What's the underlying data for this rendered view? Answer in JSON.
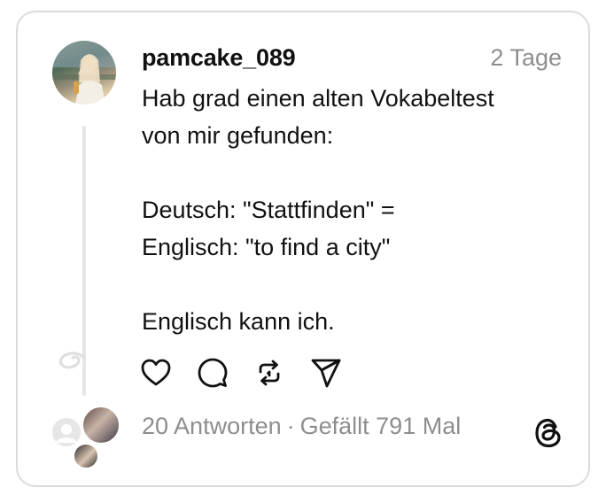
{
  "post": {
    "username": "pamcake_089",
    "time": "2 Tage",
    "text": "Hab grad einen alten Vokabeltest\nvon mir gefunden:\n\nDeutsch: \"Stattfinden\" =\nEnglisch: \"to find a city\"\n\nEnglisch kann ich."
  },
  "stats": {
    "replies": "20 Antworten",
    "separator": "·",
    "likes": "Gefällt 791 Mal"
  },
  "icons": {
    "like": "heart-icon",
    "comment": "comment-icon",
    "repost": "repost-icon",
    "share": "send-icon",
    "brand": "threads-logo-icon"
  },
  "colors": {
    "text": "#111111",
    "muted": "#8e8e8e",
    "border": "#dbdbdb",
    "thread_line": "#e6e6e6"
  }
}
